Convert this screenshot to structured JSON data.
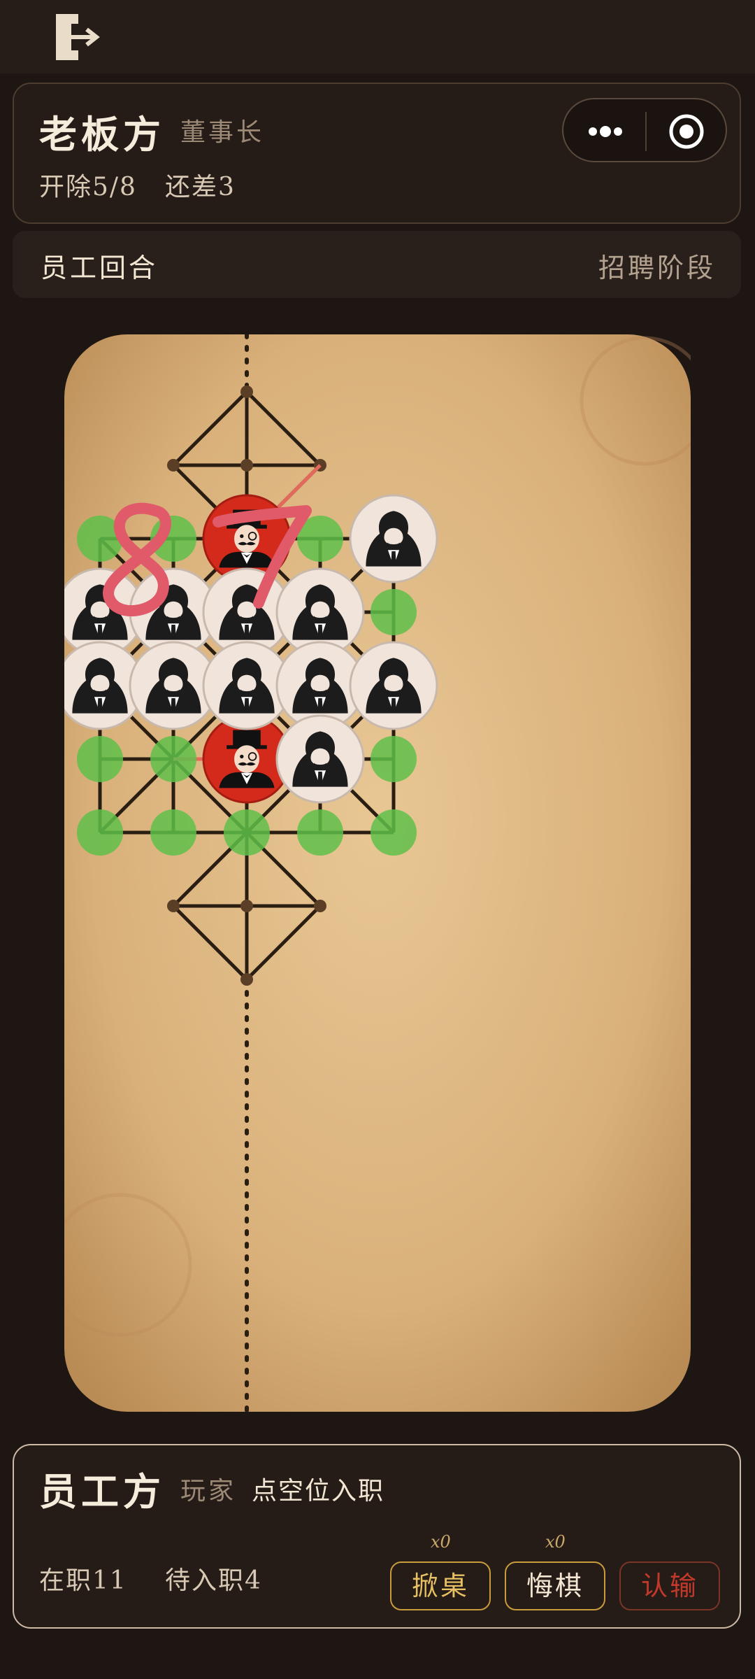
{
  "boss_panel": {
    "title": "老板方",
    "role": "董事长",
    "fired_label": "开除5/8",
    "remaining_label": "还差3"
  },
  "turn_bar": {
    "current_turn": "员工回合",
    "phase": "招聘阶段"
  },
  "board": {
    "handwritten_numbers": [
      "8",
      "7"
    ],
    "pieces": [
      {
        "type": "boss",
        "col": 2,
        "row": 2
      },
      {
        "type": "boss",
        "col": 2,
        "row": 5
      },
      {
        "type": "employee",
        "col": 4,
        "row": 2
      },
      {
        "type": "employee",
        "col": 0,
        "row": 3
      },
      {
        "type": "employee",
        "col": 1,
        "row": 3
      },
      {
        "type": "employee",
        "col": 2,
        "row": 3
      },
      {
        "type": "employee",
        "col": 3,
        "row": 3
      },
      {
        "type": "employee",
        "col": 0,
        "row": 4
      },
      {
        "type": "employee",
        "col": 1,
        "row": 4
      },
      {
        "type": "employee",
        "col": 2,
        "row": 4
      },
      {
        "type": "employee",
        "col": 3,
        "row": 4
      },
      {
        "type": "employee",
        "col": 4,
        "row": 4
      },
      {
        "type": "employee",
        "col": 3,
        "row": 5
      }
    ],
    "empty_spots": [
      {
        "col": 0,
        "row": 2
      },
      {
        "col": 1,
        "row": 2
      },
      {
        "col": 3,
        "row": 2
      },
      {
        "col": 4,
        "row": 3
      },
      {
        "col": 0,
        "row": 5
      },
      {
        "col": 1,
        "row": 5
      },
      {
        "col": 4,
        "row": 5
      },
      {
        "col": 0,
        "row": 6
      },
      {
        "col": 1,
        "row": 6
      },
      {
        "col": 2,
        "row": 6
      },
      {
        "col": 3,
        "row": 6
      },
      {
        "col": 4,
        "row": 6
      }
    ],
    "colors": {
      "boss": "#d32a1c",
      "employee": "#f1e4db",
      "highlight": "#5fbf4a",
      "last_move": "#e4695c",
      "lines": "#2a1d12"
    }
  },
  "staff_panel": {
    "title": "员工方",
    "role": "玩家",
    "hint": "点空位入职",
    "employed_label": "在职11",
    "pending_label": "待入职4",
    "buttons": [
      {
        "label": "掀桌",
        "count": "x0",
        "color": "#e7c063"
      },
      {
        "label": "悔棋",
        "count": "x0",
        "color": "#f3e7d3"
      },
      {
        "label": "认输",
        "color": "#c0392b"
      }
    ]
  }
}
